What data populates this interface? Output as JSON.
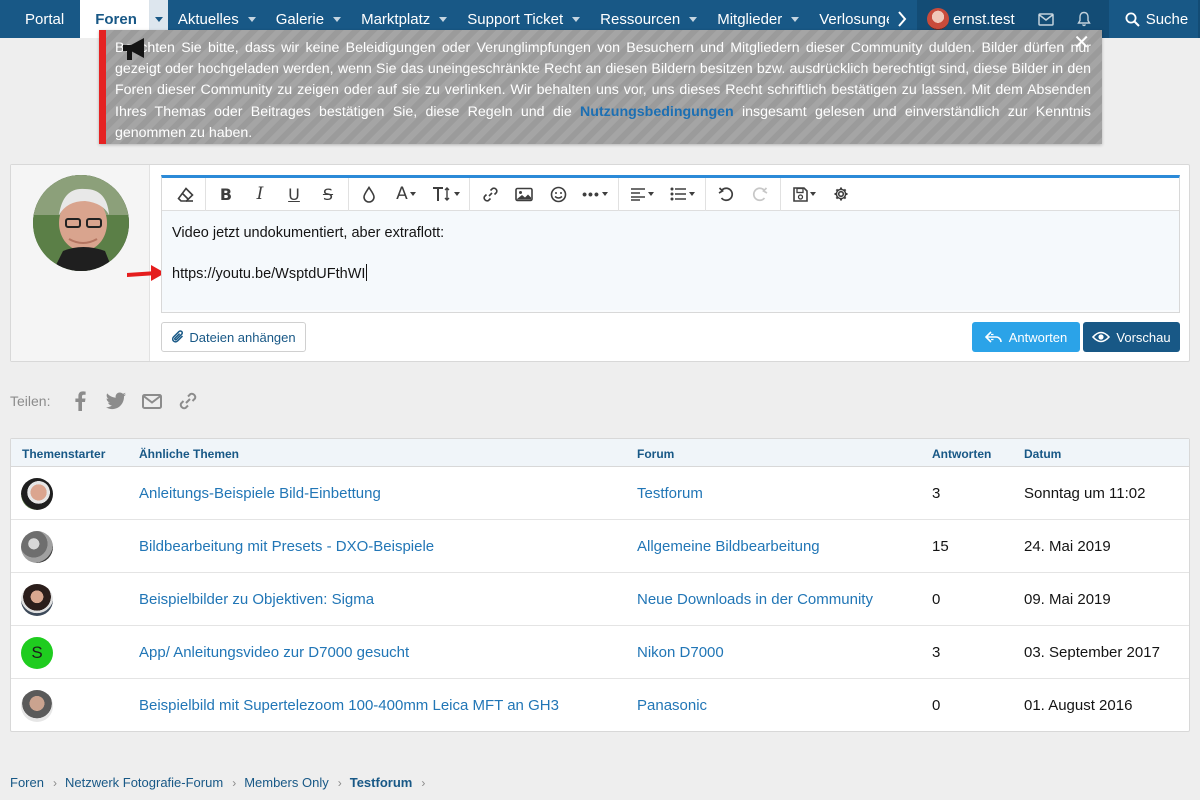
{
  "nav": {
    "items": [
      {
        "label": "Portal"
      },
      {
        "label": "Foren"
      },
      {
        "label": "Aktuelles"
      },
      {
        "label": "Galerie"
      },
      {
        "label": "Marktplatz"
      },
      {
        "label": "Support Ticket"
      },
      {
        "label": "Ressourcen"
      },
      {
        "label": "Mitglieder"
      },
      {
        "label": "Verlosunge"
      }
    ],
    "username": "ernst.test",
    "search_label": "Suche"
  },
  "notice": {
    "text_before": "Beachten Sie bitte, dass wir keine Beleidigungen oder Verunglimpfungen von Besuchern und Mitgliedern dieser Community dulden. Bilder dürfen nur gezeigt oder hochgeladen werden, wenn Sie das uneingeschränkte Recht an diesen Bildern besitzen bzw. ausdrücklich berechtigt sind, diese Bilder in den Foren dieser Community zu zeigen oder auf sie zu verlinken. Wir behalten uns vor, uns dieses Recht schriftlich bestätigen zu lassen. Mit dem Absenden Ihres Themas oder Beitrages bestätigen Sie, diese Regeln und die ",
    "link": "Nutzungsbedingungen",
    "text_after": " insgesamt gelesen und einverständlich zur Kenntnis genommen zu haben."
  },
  "editor": {
    "line1": "Video jetzt undokumentiert, aber extraflott:",
    "line2": "https://youtu.be/WsptdUFthWI"
  },
  "buttons": {
    "attach": "Dateien anhängen",
    "reply": "Antworten",
    "preview": "Vorschau"
  },
  "share": {
    "label": "Teilen:"
  },
  "similar": {
    "headers": {
      "starter": "Themenstarter",
      "title": "Ähnliche Themen",
      "forum": "Forum",
      "replies": "Antworten",
      "date": "Datum"
    },
    "rows": [
      {
        "title": "Anleitungs-Beispiele Bild-Einbettung",
        "forum": "Testforum",
        "replies": "3",
        "date": "Sonntag um 11:02",
        "avatar_letter": "",
        "avatar_color": "#b9785f"
      },
      {
        "title": "Bildbearbeitung mit Presets - DXO-Beispiele",
        "forum": "Allgemeine Bildbearbeitung",
        "replies": "15",
        "date": "24. Mai 2019",
        "avatar_letter": "",
        "avatar_color": "#8a8a8a"
      },
      {
        "title": "Beispielbilder zu Objektiven: Sigma",
        "forum": "Neue Downloads in der Community",
        "replies": "0",
        "date": "09. Mai 2019",
        "avatar_letter": "",
        "avatar_color": "#4a3a36"
      },
      {
        "title": "App/ Anleitungsvideo zur D7000 gesucht",
        "forum": "Nikon D7000",
        "replies": "3",
        "date": "03. September 2017",
        "avatar_letter": "S",
        "avatar_color": "#1fcc1f"
      },
      {
        "title": "Beispielbild mit Supertelezoom 100-400mm Leica MFT an GH3",
        "forum": "Panasonic",
        "replies": "0",
        "date": "01. August 2016",
        "avatar_letter": "",
        "avatar_color": "#6d6d6d"
      }
    ]
  },
  "breadcrumb": [
    "Foren",
    "Netzwerk Fotografie-Forum",
    "Members Only",
    "Testforum"
  ],
  "colors": {
    "nav_bg": "#185886",
    "accent": "#2ba3e8",
    "link": "#2176b6",
    "notice_border": "#e52222"
  }
}
